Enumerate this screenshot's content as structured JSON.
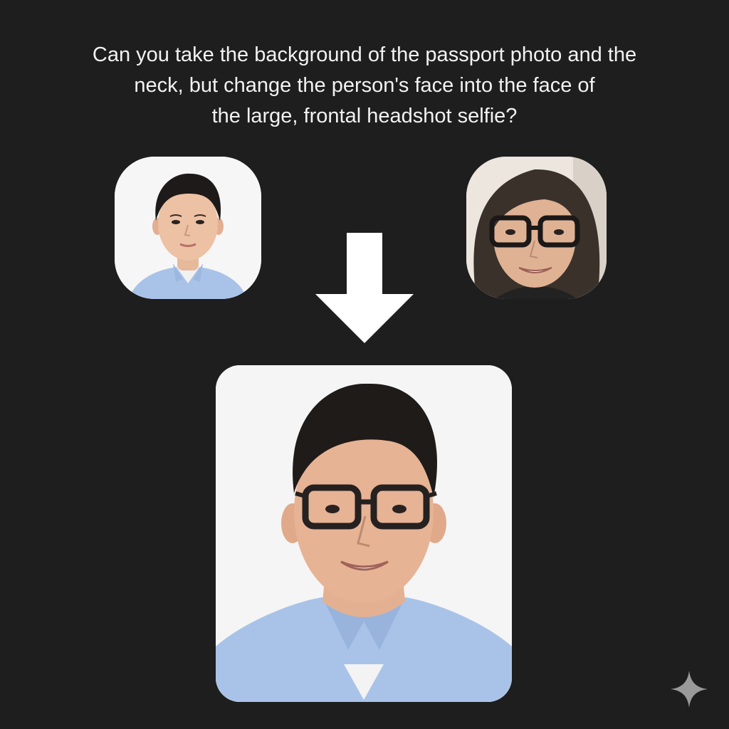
{
  "prompt": {
    "lines": [
      "Can you take the background of the passport photo and the",
      "neck, but change the person's face into the face of",
      "the large, frontal headshot selfie?"
    ]
  },
  "images": {
    "passport_photo": "passport-photo",
    "selfie_photo": "selfie-photo",
    "result_photo": "result-photo"
  },
  "icons": {
    "transform_arrow": "arrow-down-icon",
    "watermark": "sparkle-icon"
  },
  "colors": {
    "background": "#1e1e1e",
    "text": "#f2f2f2",
    "arrow": "#ffffff",
    "sparkle": "#9a9a9a",
    "shirt": "#a9c3e8"
  }
}
